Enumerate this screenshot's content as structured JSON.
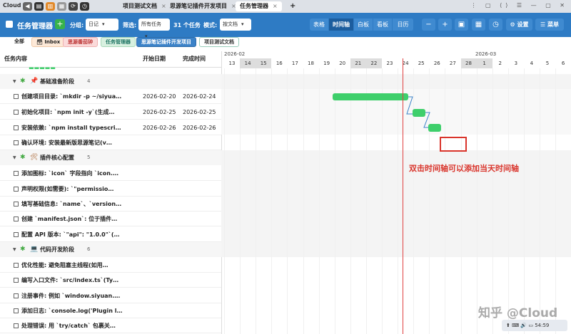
{
  "titlebar": {
    "logo": "Cloud",
    "tabs": [
      {
        "label": "项目测试文档"
      },
      {
        "label": "思源笔记插件开发项目"
      },
      {
        "label": "任务管理器"
      }
    ],
    "plus": "+",
    "right_icons": "⋮ ▢ ⟨⟩ ☰ — ▢ ✕"
  },
  "toolbar": {
    "title": "任务管理器",
    "add": "+",
    "group_label": "分组:",
    "group_value": "日记",
    "filter_label": "筛选:",
    "filter_value": "所有任务",
    "task_count": "31 个任务",
    "mode_label": "模式:",
    "mode_value": "按文档",
    "views": [
      {
        "label": "表格",
        "active": false
      },
      {
        "label": "时间轴",
        "active": true
      },
      {
        "label": "白板",
        "active": false
      },
      {
        "label": "看板",
        "active": false
      },
      {
        "label": "日历",
        "active": false
      }
    ],
    "icon_buttons": [
      "−",
      "+",
      "▣",
      "▦",
      "◷",
      "⚙"
    ],
    "settings": "设置",
    "menu": "菜单"
  },
  "categories": [
    {
      "label": "全部",
      "color": "#ffffff"
    },
    {
      "label": "Inbox",
      "color": "#fde9d8"
    },
    {
      "label": "思源番茄钟",
      "color": "#fbdada"
    },
    {
      "label": "任务管理器",
      "color": "#d8f0e0"
    },
    {
      "label": "思源笔记插件开发项目",
      "color": "#3b82c8"
    },
    {
      "label": "项目测试文档",
      "color": "#ffffff"
    }
  ],
  "table": {
    "headers": [
      "任务内容",
      "开始日期",
      "完成时间"
    ],
    "groups": [
      {
        "title": "基础准备阶段",
        "icon": "📌",
        "count": "4",
        "tasks": [
          {
            "name": "创建项目目录: `mkdir -p ~/siyua…",
            "start": "2026-02-20",
            "end": "2026-02-24"
          },
          {
            "name": "初始化项目: `npm init -y`(生成…",
            "start": "2026-02-25",
            "end": "2026-02-25"
          },
          {
            "name": "安装依赖: `npm install typescri…",
            "start": "2026-02-26",
            "end": "2026-02-26"
          },
          {
            "name": "确认环境: 安装最新版思源笔记(v…",
            "start": "",
            "end": ""
          }
        ]
      },
      {
        "title": "插件核心配置",
        "icon": "🛠",
        "count": "5",
        "tasks": [
          {
            "name": "添加图标: `icon` 字段指向 `icon.…",
            "start": "",
            "end": ""
          },
          {
            "name": "声明权限(如需要): `\"permissio…",
            "start": "",
            "end": ""
          },
          {
            "name": "填写基础信息: `name`、`version…",
            "start": "",
            "end": ""
          },
          {
            "name": "创建 `manifest.json`: 位于插件…",
            "start": "",
            "end": ""
          },
          {
            "name": "配置 API 版本: `\"api\": \"1.0.0\"`(…",
            "start": "",
            "end": ""
          }
        ]
      },
      {
        "title": "代码开发阶段",
        "icon": "💻",
        "count": "6",
        "tasks": [
          {
            "name": "优化性能: 避免阻塞主线程(如用…",
            "start": "",
            "end": ""
          },
          {
            "name": "编写入口文件: `src/index.ts`(Ty…",
            "start": "",
            "end": ""
          },
          {
            "name": "注册事件: 例如 `window.siyuan.…",
            "start": "",
            "end": ""
          },
          {
            "name": "添加日志: `console.log('Plugin l…",
            "start": "",
            "end": ""
          },
          {
            "name": "处理错误: 用 `try/catch` 包裹关…",
            "start": "",
            "end": ""
          }
        ]
      }
    ]
  },
  "gantt": {
    "months": [
      {
        "label": "2026-02"
      },
      {
        "label": "2026-03"
      }
    ],
    "days": [
      "13",
      "14",
      "15",
      "16",
      "17",
      "18",
      "19",
      "20",
      "21",
      "22",
      "23",
      "24",
      "25",
      "26",
      "27",
      "28",
      "1",
      "2",
      "3",
      "4",
      "5",
      "6"
    ],
    "weekend_days": [
      "14",
      "15",
      "21",
      "22",
      "28",
      "1"
    ],
    "today": "24",
    "annotation": "双击时间轴可以添加当天时间轴"
  },
  "watermark": "知乎 @Cloud",
  "taskbar": {
    "time": "54:59"
  }
}
